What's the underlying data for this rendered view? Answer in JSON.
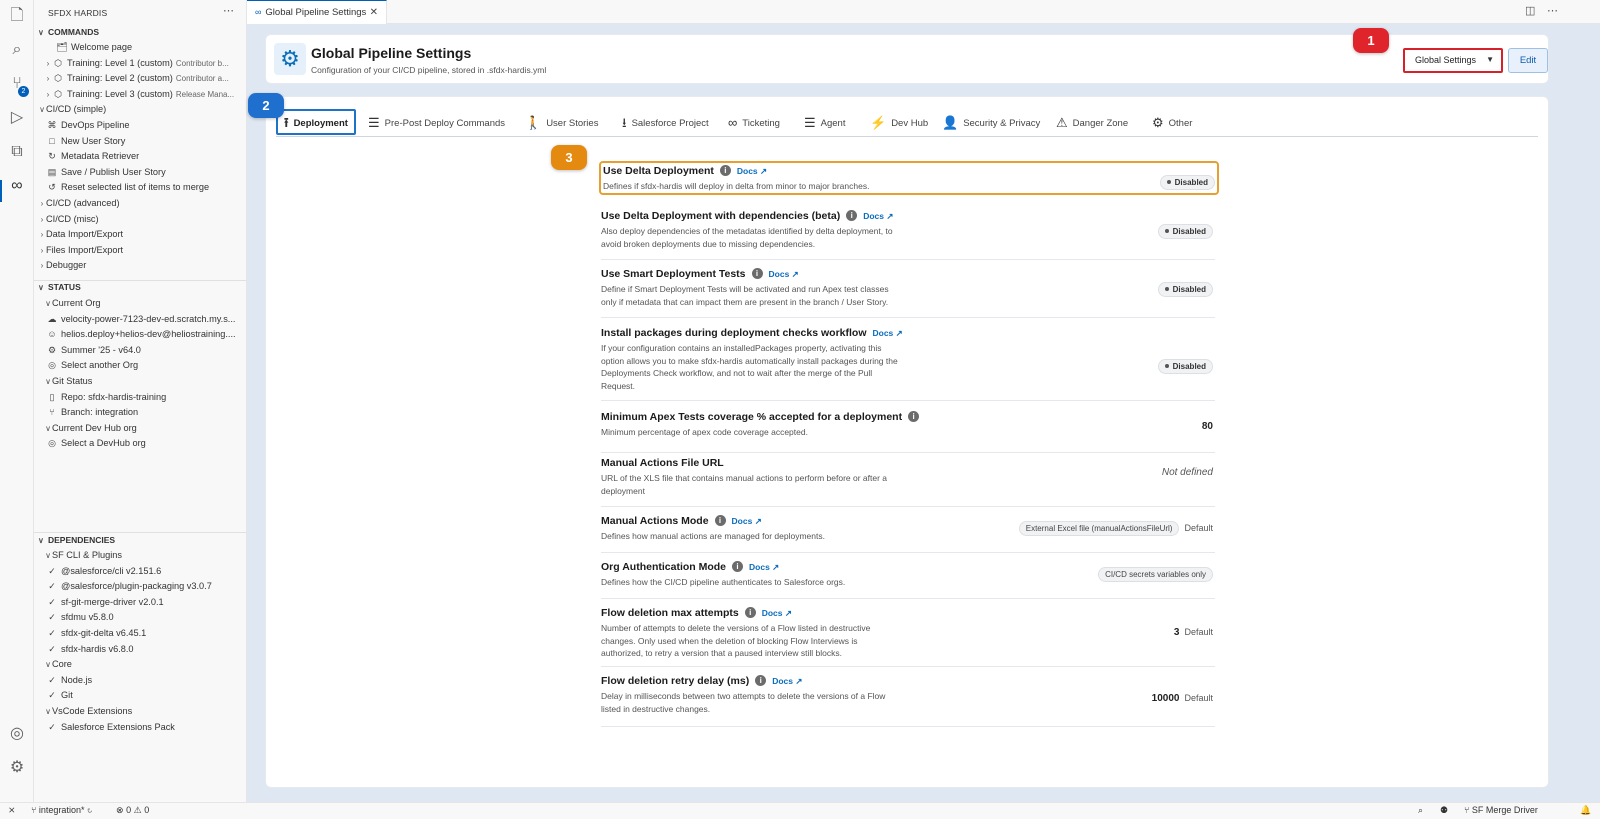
{
  "editor_tab": {
    "label": "Global Pipeline Settings"
  },
  "sidebar": {
    "title": "SFDX HARDIS",
    "commands": {
      "header": "COMMANDS",
      "items": [
        {
          "label": "Welcome page",
          "desc": ""
        },
        {
          "label": "Training: Level 1 (custom)",
          "desc": "Contributor b..."
        },
        {
          "label": "Training: Level 2 (custom)",
          "desc": "Contributor a..."
        },
        {
          "label": "Training: Level 3 (custom)",
          "desc": "Release Mana..."
        },
        {
          "label": "CI/CD (simple)",
          "desc": ""
        },
        {
          "label": "DevOps Pipeline",
          "desc": ""
        },
        {
          "label": "New User Story",
          "desc": ""
        },
        {
          "label": "Metadata Retriever",
          "desc": ""
        },
        {
          "label": "Save / Publish User Story",
          "desc": ""
        },
        {
          "label": "Reset selected list of items to merge",
          "desc": ""
        },
        {
          "label": "CI/CD (advanced)",
          "desc": ""
        },
        {
          "label": "CI/CD (misc)",
          "desc": ""
        },
        {
          "label": "Data Import/Export",
          "desc": ""
        },
        {
          "label": "Files Import/Export",
          "desc": ""
        },
        {
          "label": "Debugger",
          "desc": ""
        }
      ]
    },
    "status": {
      "header": "STATUS",
      "items": [
        {
          "label": "Current Org"
        },
        {
          "label": "velocity-power-7123-dev-ed.scratch.my.s..."
        },
        {
          "label": "helios.deploy+helios-dev@heliostraining...."
        },
        {
          "label": "Summer '25 - v64.0"
        },
        {
          "label": "Select another Org"
        },
        {
          "label": "Git Status"
        },
        {
          "label": "Repo: sfdx-hardis-training"
        },
        {
          "label": "Branch: integration"
        },
        {
          "label": "Current Dev Hub org"
        },
        {
          "label": "Select a DevHub org"
        }
      ]
    },
    "dependencies": {
      "header": "DEPENDENCIES",
      "items": [
        {
          "label": "SF CLI & Plugins"
        },
        {
          "label": "@salesforce/cli v2.151.6"
        },
        {
          "label": "@salesforce/plugin-packaging v3.0.7"
        },
        {
          "label": "sf-git-merge-driver v2.0.1"
        },
        {
          "label": "sfdmu v5.8.0"
        },
        {
          "label": "sfdx-git-delta v6.45.1"
        },
        {
          "label": "sfdx-hardis v6.8.0"
        },
        {
          "label": "Core"
        },
        {
          "label": "Node.js"
        },
        {
          "label": "Git"
        },
        {
          "label": "VsCode Extensions"
        },
        {
          "label": "Salesforce Extensions Pack"
        }
      ]
    }
  },
  "header": {
    "title": "Global Pipeline Settings",
    "subtitle": "Configuration of your CI/CD pipeline, stored in .sfdx-hardis.yml",
    "select_value": "Global Settings",
    "edit_label": "Edit"
  },
  "badges": {
    "one": "1",
    "two": "2",
    "three": "3"
  },
  "tabs": [
    {
      "label": "Deployment",
      "icon": "upload-icon"
    },
    {
      "label": "Pre-Post Deploy Commands",
      "icon": "list-check-icon"
    },
    {
      "label": "User Stories",
      "icon": "walker-icon"
    },
    {
      "label": "Salesforce Project",
      "icon": "download-tray-icon"
    },
    {
      "label": "Ticketing",
      "icon": "link-icon"
    },
    {
      "label": "Agent",
      "icon": "list-check-icon"
    },
    {
      "label": "Dev Hub",
      "icon": "bolt-icon"
    },
    {
      "label": "Security & Privacy",
      "icon": "user-lock-icon"
    },
    {
      "label": "Danger Zone",
      "icon": "warning-icon"
    },
    {
      "label": "Other",
      "icon": "gear-icon"
    }
  ],
  "docs_label": "Docs ↗",
  "default_label": "Default",
  "settings": [
    {
      "title": "Use Delta Deployment",
      "desc": "Defines if sfdx-hardis will deploy in delta from minor to major branches.",
      "value": "Disabled"
    },
    {
      "title": "Use Delta Deployment with dependencies (beta)",
      "desc": "Also deploy dependencies of the metadatas identified by delta deployment, to avoid broken deployments due to missing dependencies.",
      "value": "Disabled"
    },
    {
      "title": "Use Smart Deployment Tests",
      "desc": "Define if Smart Deployment Tests will be activated and run Apex test classes only if metadata that can impact them are present in the branch / User Story.",
      "value": "Disabled"
    },
    {
      "title": "Install packages during deployment checks workflow",
      "desc": "If your configuration contains an installedPackages property, activating this option allows you to make sfdx-hardis automatically install packages during the Deployments Check workflow, and not to wait after the merge of the Pull Request.",
      "value": "Disabled"
    },
    {
      "title": "Minimum Apex Tests coverage % accepted for a deployment",
      "desc": "Minimum percentage of apex code coverage accepted.",
      "value": "80"
    },
    {
      "title": "Manual Actions File URL",
      "desc": "URL of the XLS file that contains manual actions to perform before or after a deployment",
      "value": "Not defined"
    },
    {
      "title": "Manual Actions Mode",
      "desc": "Defines how manual actions are managed for deployments.",
      "value": "External Excel file (manualActionsFileUrl)"
    },
    {
      "title": "Org Authentication Mode",
      "desc": "Defines how the CI/CD pipeline authenticates to Salesforce orgs.",
      "value": "CI/CD secrets variables only"
    },
    {
      "title": "Flow deletion max attempts",
      "desc": "Number of attempts to delete the versions of a Flow listed in destructive changes. Only used when the deletion of blocking Flow Interviews is authorized, to retry a version that a paused interview still blocks.",
      "value": "3"
    },
    {
      "title": "Flow deletion retry delay (ms)",
      "desc": "Delay in milliseconds between two attempts to delete the versions of a Flow listed in destructive changes.",
      "value": "10000"
    }
  ],
  "statusbar": {
    "branch": "integration*",
    "problems": "0",
    "warnings": "0",
    "merge_driver": "SF Merge Driver"
  }
}
